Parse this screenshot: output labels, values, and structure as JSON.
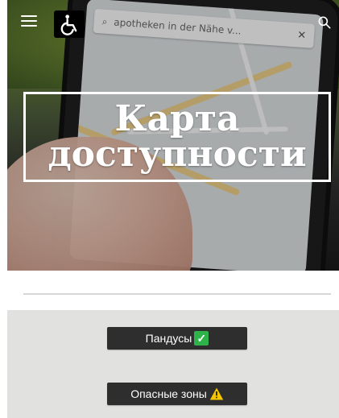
{
  "hero": {
    "title_line1": "Карта",
    "title_line2": "доступности",
    "photo_search_text": "apotheken in der Nähe v..."
  },
  "header": {
    "menu_icon": "hamburger-menu-icon",
    "logo_icon": "wheelchair-icon",
    "search_icon": "search-icon"
  },
  "actions": {
    "ramps_label": "Пандусы",
    "danger_label": "Опасные зоны"
  },
  "colors": {
    "button_bg": "#2e2e2e",
    "panel_bg": "#e1e1df",
    "check_green": "#2db34a",
    "warning_yellow": "#f6c400"
  }
}
